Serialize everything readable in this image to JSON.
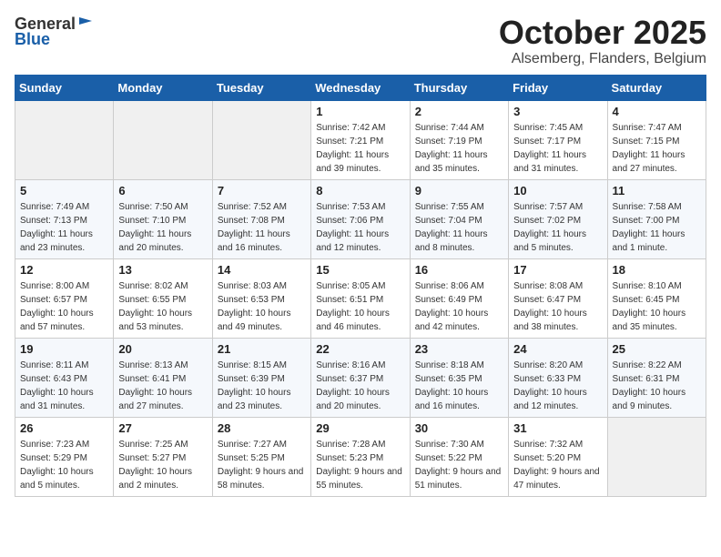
{
  "header": {
    "logo_line1": "General",
    "logo_line2": "Blue",
    "month": "October 2025",
    "location": "Alsemberg, Flanders, Belgium"
  },
  "weekdays": [
    "Sunday",
    "Monday",
    "Tuesday",
    "Wednesday",
    "Thursday",
    "Friday",
    "Saturday"
  ],
  "weeks": [
    [
      {
        "day": "",
        "sunrise": "",
        "sunset": "",
        "daylight": ""
      },
      {
        "day": "",
        "sunrise": "",
        "sunset": "",
        "daylight": ""
      },
      {
        "day": "",
        "sunrise": "",
        "sunset": "",
        "daylight": ""
      },
      {
        "day": "1",
        "sunrise": "Sunrise: 7:42 AM",
        "sunset": "Sunset: 7:21 PM",
        "daylight": "Daylight: 11 hours and 39 minutes."
      },
      {
        "day": "2",
        "sunrise": "Sunrise: 7:44 AM",
        "sunset": "Sunset: 7:19 PM",
        "daylight": "Daylight: 11 hours and 35 minutes."
      },
      {
        "day": "3",
        "sunrise": "Sunrise: 7:45 AM",
        "sunset": "Sunset: 7:17 PM",
        "daylight": "Daylight: 11 hours and 31 minutes."
      },
      {
        "day": "4",
        "sunrise": "Sunrise: 7:47 AM",
        "sunset": "Sunset: 7:15 PM",
        "daylight": "Daylight: 11 hours and 27 minutes."
      }
    ],
    [
      {
        "day": "5",
        "sunrise": "Sunrise: 7:49 AM",
        "sunset": "Sunset: 7:13 PM",
        "daylight": "Daylight: 11 hours and 23 minutes."
      },
      {
        "day": "6",
        "sunrise": "Sunrise: 7:50 AM",
        "sunset": "Sunset: 7:10 PM",
        "daylight": "Daylight: 11 hours and 20 minutes."
      },
      {
        "day": "7",
        "sunrise": "Sunrise: 7:52 AM",
        "sunset": "Sunset: 7:08 PM",
        "daylight": "Daylight: 11 hours and 16 minutes."
      },
      {
        "day": "8",
        "sunrise": "Sunrise: 7:53 AM",
        "sunset": "Sunset: 7:06 PM",
        "daylight": "Daylight: 11 hours and 12 minutes."
      },
      {
        "day": "9",
        "sunrise": "Sunrise: 7:55 AM",
        "sunset": "Sunset: 7:04 PM",
        "daylight": "Daylight: 11 hours and 8 minutes."
      },
      {
        "day": "10",
        "sunrise": "Sunrise: 7:57 AM",
        "sunset": "Sunset: 7:02 PM",
        "daylight": "Daylight: 11 hours and 5 minutes."
      },
      {
        "day": "11",
        "sunrise": "Sunrise: 7:58 AM",
        "sunset": "Sunset: 7:00 PM",
        "daylight": "Daylight: 11 hours and 1 minute."
      }
    ],
    [
      {
        "day": "12",
        "sunrise": "Sunrise: 8:00 AM",
        "sunset": "Sunset: 6:57 PM",
        "daylight": "Daylight: 10 hours and 57 minutes."
      },
      {
        "day": "13",
        "sunrise": "Sunrise: 8:02 AM",
        "sunset": "Sunset: 6:55 PM",
        "daylight": "Daylight: 10 hours and 53 minutes."
      },
      {
        "day": "14",
        "sunrise": "Sunrise: 8:03 AM",
        "sunset": "Sunset: 6:53 PM",
        "daylight": "Daylight: 10 hours and 49 minutes."
      },
      {
        "day": "15",
        "sunrise": "Sunrise: 8:05 AM",
        "sunset": "Sunset: 6:51 PM",
        "daylight": "Daylight: 10 hours and 46 minutes."
      },
      {
        "day": "16",
        "sunrise": "Sunrise: 8:06 AM",
        "sunset": "Sunset: 6:49 PM",
        "daylight": "Daylight: 10 hours and 42 minutes."
      },
      {
        "day": "17",
        "sunrise": "Sunrise: 8:08 AM",
        "sunset": "Sunset: 6:47 PM",
        "daylight": "Daylight: 10 hours and 38 minutes."
      },
      {
        "day": "18",
        "sunrise": "Sunrise: 8:10 AM",
        "sunset": "Sunset: 6:45 PM",
        "daylight": "Daylight: 10 hours and 35 minutes."
      }
    ],
    [
      {
        "day": "19",
        "sunrise": "Sunrise: 8:11 AM",
        "sunset": "Sunset: 6:43 PM",
        "daylight": "Daylight: 10 hours and 31 minutes."
      },
      {
        "day": "20",
        "sunrise": "Sunrise: 8:13 AM",
        "sunset": "Sunset: 6:41 PM",
        "daylight": "Daylight: 10 hours and 27 minutes."
      },
      {
        "day": "21",
        "sunrise": "Sunrise: 8:15 AM",
        "sunset": "Sunset: 6:39 PM",
        "daylight": "Daylight: 10 hours and 23 minutes."
      },
      {
        "day": "22",
        "sunrise": "Sunrise: 8:16 AM",
        "sunset": "Sunset: 6:37 PM",
        "daylight": "Daylight: 10 hours and 20 minutes."
      },
      {
        "day": "23",
        "sunrise": "Sunrise: 8:18 AM",
        "sunset": "Sunset: 6:35 PM",
        "daylight": "Daylight: 10 hours and 16 minutes."
      },
      {
        "day": "24",
        "sunrise": "Sunrise: 8:20 AM",
        "sunset": "Sunset: 6:33 PM",
        "daylight": "Daylight: 10 hours and 12 minutes."
      },
      {
        "day": "25",
        "sunrise": "Sunrise: 8:22 AM",
        "sunset": "Sunset: 6:31 PM",
        "daylight": "Daylight: 10 hours and 9 minutes."
      }
    ],
    [
      {
        "day": "26",
        "sunrise": "Sunrise: 7:23 AM",
        "sunset": "Sunset: 5:29 PM",
        "daylight": "Daylight: 10 hours and 5 minutes."
      },
      {
        "day": "27",
        "sunrise": "Sunrise: 7:25 AM",
        "sunset": "Sunset: 5:27 PM",
        "daylight": "Daylight: 10 hours and 2 minutes."
      },
      {
        "day": "28",
        "sunrise": "Sunrise: 7:27 AM",
        "sunset": "Sunset: 5:25 PM",
        "daylight": "Daylight: 9 hours and 58 minutes."
      },
      {
        "day": "29",
        "sunrise": "Sunrise: 7:28 AM",
        "sunset": "Sunset: 5:23 PM",
        "daylight": "Daylight: 9 hours and 55 minutes."
      },
      {
        "day": "30",
        "sunrise": "Sunrise: 7:30 AM",
        "sunset": "Sunset: 5:22 PM",
        "daylight": "Daylight: 9 hours and 51 minutes."
      },
      {
        "day": "31",
        "sunrise": "Sunrise: 7:32 AM",
        "sunset": "Sunset: 5:20 PM",
        "daylight": "Daylight: 9 hours and 47 minutes."
      },
      {
        "day": "",
        "sunrise": "",
        "sunset": "",
        "daylight": ""
      }
    ]
  ]
}
